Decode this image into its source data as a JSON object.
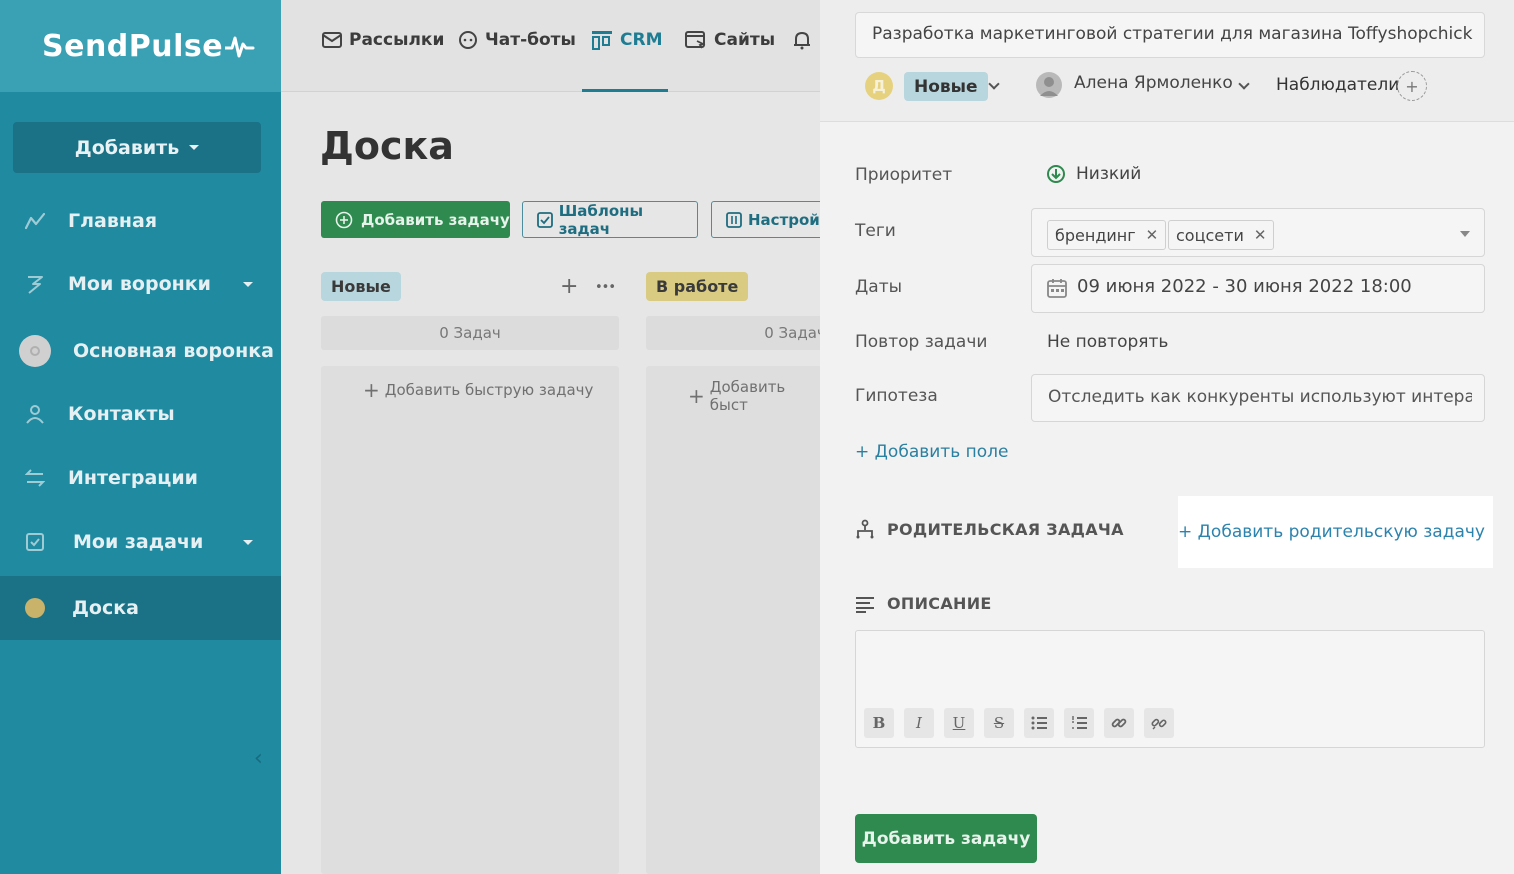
{
  "sidebar": {
    "logo": "SendPulse",
    "add_button": "Добавить",
    "items": [
      {
        "label": "Главная"
      },
      {
        "label": "Мои воронки"
      },
      {
        "label": "Основная воронка"
      },
      {
        "label": "Контакты"
      },
      {
        "label": "Интеграции"
      },
      {
        "label": "Мои задачи"
      },
      {
        "label": "Доска"
      }
    ],
    "collapse_glyph": "‹"
  },
  "topnav": {
    "items": [
      {
        "label": "Рассылки",
        "icon": "mail-icon"
      },
      {
        "label": "Чат-боты",
        "icon": "chat-bot-icon"
      },
      {
        "label": "CRM",
        "icon": "crm-icon"
      },
      {
        "label": "Сайты",
        "icon": "sites-icon"
      },
      {
        "label": "",
        "icon": "bell-icon"
      }
    ],
    "active": "CRM"
  },
  "board": {
    "title": "Доска",
    "add_task": "Добавить задачу",
    "templates": "Шаблоны задач",
    "settings": "Настройк",
    "columns": [
      {
        "name": "Новые",
        "count": "0 Задач",
        "quick_add": "Добавить быструю задачу",
        "color": "#b8d6de"
      },
      {
        "name": "В работе",
        "count": "0 Задач",
        "quick_add": "Добавить быст",
        "color": "#e6d27e"
      }
    ],
    "col_add_glyph": "+",
    "col_more_glyph": "•••"
  },
  "task": {
    "title": "Разработка маркетинговой стратегии для магазина Toffyshopchick",
    "status_avatar": "Д",
    "status": "Новые",
    "assignee": "Алена Ярмоленко",
    "observers_label": "Наблюдатели",
    "observers_add": "+",
    "fields": {
      "priority_label": "Приоритет",
      "priority_value": "Низкий",
      "tags_label": "Теги",
      "tags": [
        {
          "label": "брендинг",
          "x": "✕"
        },
        {
          "label": "соцсети",
          "x": "✕"
        }
      ],
      "dates_label": "Даты",
      "dates_value": "09 июня 2022 - 30 июня 2022 18:00",
      "repeat_label": "Повтор задачи",
      "repeat_value": "Не повторять",
      "hypothesis_label": "Гипотеза",
      "hypothesis_value": "Отследить как конкуренты используют интеракт"
    },
    "add_field": "+ Добавить поле",
    "parent_label": "РОДИТЕЛЬСКАЯ ЗАДАЧА",
    "add_parent": "+ Добавить родительскую задачу",
    "description_label": "ОПИСАНИЕ",
    "toolbar": {
      "bold": "B",
      "italic": "I",
      "underline": "U",
      "strike": "S"
    },
    "submit": "Добавить задачу"
  },
  "colors": {
    "sidebar": "#1f8aa0",
    "accent_green": "#2e8a4f",
    "link_blue": "#2b83ae"
  }
}
